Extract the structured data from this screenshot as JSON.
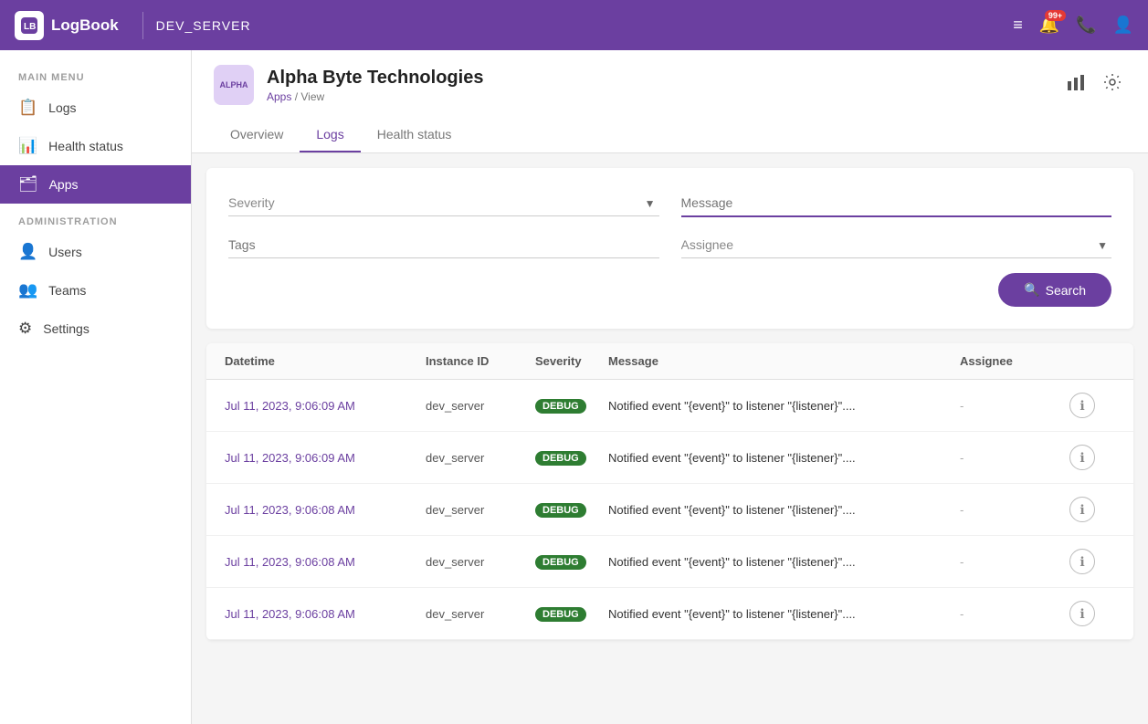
{
  "topnav": {
    "brand_icon": "LB",
    "brand_name": "LogBook",
    "server": "DEV_SERVER",
    "notification_count": "99+"
  },
  "sidebar": {
    "main_menu_label": "MAIN MENU",
    "admin_label": "ADMINISTRATION",
    "items_main": [
      {
        "id": "logs",
        "label": "Logs",
        "icon": "📋"
      },
      {
        "id": "health-status",
        "label": "Health status",
        "icon": "💓"
      },
      {
        "id": "apps",
        "label": "Apps",
        "icon": "🗂️",
        "active": true
      }
    ],
    "items_admin": [
      {
        "id": "users",
        "label": "Users",
        "icon": "👤"
      },
      {
        "id": "teams",
        "label": "Teams",
        "icon": "👥"
      },
      {
        "id": "settings",
        "label": "Settings",
        "icon": "⚙️"
      }
    ]
  },
  "app_header": {
    "logo_text": "ALPHA",
    "title": "Alpha Byte Technologies",
    "breadcrumb_apps": "Apps",
    "breadcrumb_sep": "/",
    "breadcrumb_view": "View"
  },
  "tabs": [
    {
      "id": "overview",
      "label": "Overview",
      "active": false
    },
    {
      "id": "logs",
      "label": "Logs",
      "active": true
    },
    {
      "id": "health-status",
      "label": "Health status",
      "active": false
    }
  ],
  "filter": {
    "severity_placeholder": "Severity",
    "message_placeholder": "Message",
    "tags_placeholder": "Tags",
    "assignee_placeholder": "Assignee",
    "search_label": "Search"
  },
  "table": {
    "columns": [
      "Datetime",
      "Instance ID",
      "Severity",
      "Message",
      "Assignee",
      ""
    ],
    "rows": [
      {
        "datetime": "Jul 11, 2023, 9:06:09 AM",
        "instance": "dev_server",
        "severity": "DEBUG",
        "message": "Notified event \"{event}\" to listener \"{listener}\"....",
        "assignee": "-"
      },
      {
        "datetime": "Jul 11, 2023, 9:06:09 AM",
        "instance": "dev_server",
        "severity": "DEBUG",
        "message": "Notified event \"{event}\" to listener \"{listener}\"....",
        "assignee": "-"
      },
      {
        "datetime": "Jul 11, 2023, 9:06:08 AM",
        "instance": "dev_server",
        "severity": "DEBUG",
        "message": "Notified event \"{event}\" to listener \"{listener}\"....",
        "assignee": "-"
      },
      {
        "datetime": "Jul 11, 2023, 9:06:08 AM",
        "instance": "dev_server",
        "severity": "DEBUG",
        "message": "Notified event \"{event}\" to listener \"{listener}\"....",
        "assignee": "-"
      },
      {
        "datetime": "Jul 11, 2023, 9:06:08 AM",
        "instance": "dev_server",
        "severity": "DEBUG",
        "message": "Notified event \"{event}\" to listener \"{listener}\"....",
        "assignee": "-"
      }
    ]
  }
}
